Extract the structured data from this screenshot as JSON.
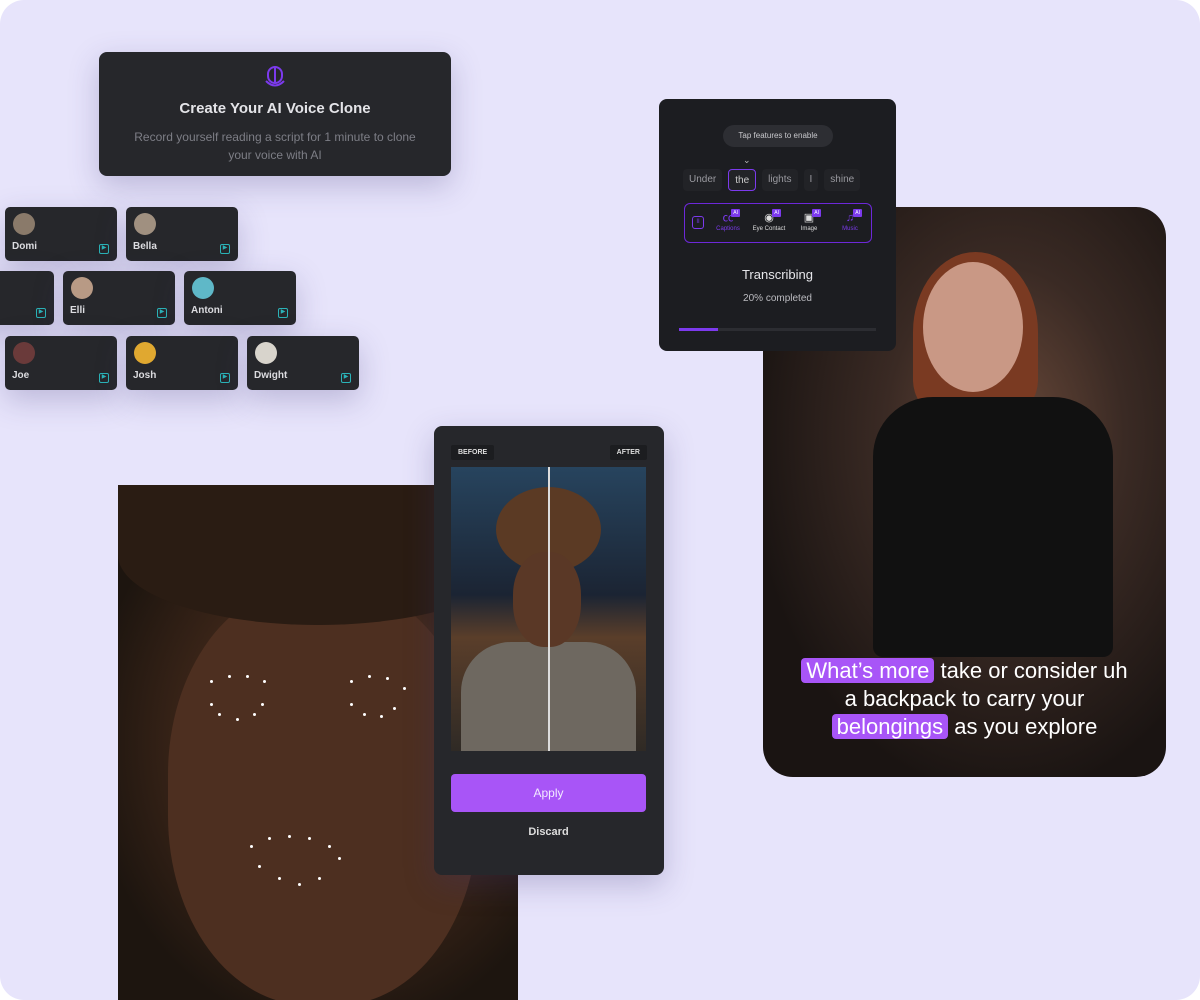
{
  "voice_clone": {
    "title": "Create Your AI Voice Clone",
    "description": "Record yourself reading a script for 1 minute to clone your voice with AI",
    "icon": "microphone-icon"
  },
  "voices": [
    {
      "name": "Domi",
      "color": "#8a7a6a"
    },
    {
      "name": "Bella",
      "color": "#a09080"
    },
    {
      "name": "",
      "color": ""
    },
    {
      "name": "Elli",
      "color": "#b89a85"
    },
    {
      "name": "Antoni",
      "color": "#5fb8c8"
    },
    {
      "name": "Joe",
      "color": "#6a3a3a"
    },
    {
      "name": "Josh",
      "color": "#e0a830"
    },
    {
      "name": "Dwight",
      "color": "#d8d4cc"
    }
  ],
  "transcribe": {
    "hint": "Tap features to enable",
    "words": [
      "Under",
      "the",
      "lights",
      "I",
      "shine"
    ],
    "selected_word": "the",
    "features": [
      {
        "label": "Captions",
        "badge": "AI"
      },
      {
        "label": "Eye Contact",
        "badge": "AI"
      },
      {
        "label": "Image",
        "badge": "AI"
      },
      {
        "label": "Music",
        "badge": "AI"
      }
    ],
    "status": "Transcribing",
    "progress_text": "20% completed",
    "progress_percent": 20
  },
  "captions": {
    "highlight1": "What’s more",
    "line1_rest": " take or consider uh",
    "line2": "a backpack to carry your",
    "highlight2": "belongings",
    "line3_rest": " as you explore"
  },
  "before_after": {
    "before_label": "BEFORE",
    "after_label": "AFTER",
    "apply_label": "Apply",
    "discard_label": "Discard"
  },
  "colors": {
    "accent": "#a855f7",
    "accent_dark": "#7c3aed",
    "background": "#e7e4fb",
    "card": "#26272b"
  }
}
